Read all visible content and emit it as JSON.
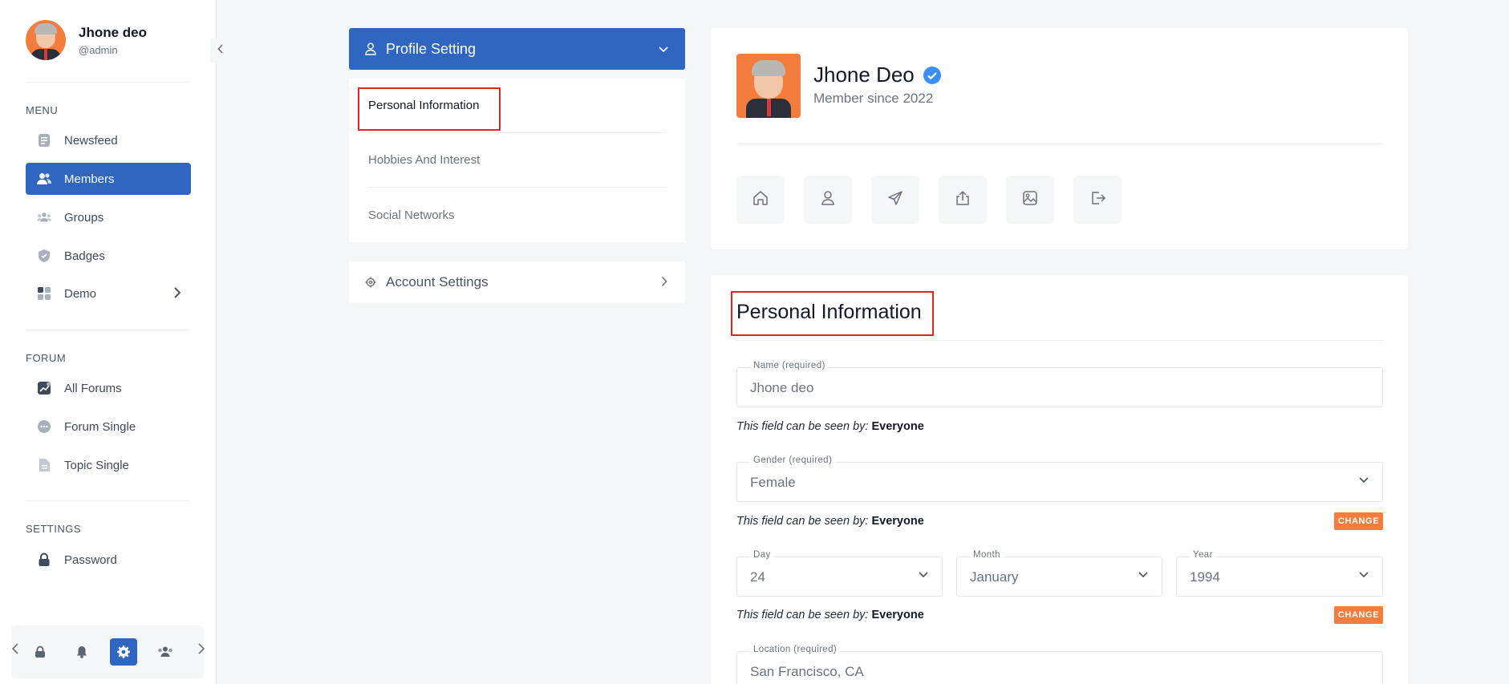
{
  "user": {
    "name": "Jhone deo",
    "handle": "@admin"
  },
  "sidebar": {
    "menu_title": "MENU",
    "menu": [
      {
        "label": "Newsfeed",
        "icon": "newsfeed-icon"
      },
      {
        "label": "Members",
        "icon": "members-icon",
        "active": true
      },
      {
        "label": "Groups",
        "icon": "groups-icon"
      },
      {
        "label": "Badges",
        "icon": "badges-icon"
      },
      {
        "label": "Demo",
        "icon": "grid-icon",
        "has_submenu": true
      }
    ],
    "forum_title": "FORUM",
    "forum": [
      {
        "label": "All Forums",
        "icon": "chart-icon"
      },
      {
        "label": "Forum Single",
        "icon": "chat-icon"
      },
      {
        "label": "Topic Single",
        "icon": "document-icon"
      }
    ],
    "settings_title": "SETTINGS",
    "settings": [
      {
        "label": "Password",
        "icon": "lock-icon"
      }
    ],
    "bottom_bar": [
      "lock-icon",
      "bell-icon",
      "gear-icon",
      "users-icon"
    ]
  },
  "settings_panel": {
    "profile_setting": "Profile Setting",
    "items": [
      "Personal Information",
      "Hobbies And Interest",
      "Social Networks"
    ],
    "account_settings": "Account Settings"
  },
  "profile_card": {
    "name": "Jhone Deo",
    "member_since": "Member since 2022",
    "actions": [
      "home-icon",
      "user-icon",
      "send-icon",
      "upload-icon",
      "image-icon",
      "logout-icon"
    ]
  },
  "form": {
    "title": "Personal Information",
    "name_label": "Name (required)",
    "name_value": "Jhone deo",
    "gender_label": "Gender (required)",
    "gender_value": "Female",
    "day_label": "Day",
    "day_value": "24",
    "month_label": "Month",
    "month_value": "January",
    "year_label": "Year",
    "year_value": "1994",
    "location_label": "Location (required)",
    "location_value": "San Francisco, CA",
    "seen_prefix": "This field can be seen by:",
    "seen_value": "Everyone",
    "change_label": "CHANGE"
  },
  "colors": {
    "primary": "#2f66c1",
    "accent": "#f47c3c",
    "highlight": "#e02424",
    "verified": "#3b8ff3"
  }
}
